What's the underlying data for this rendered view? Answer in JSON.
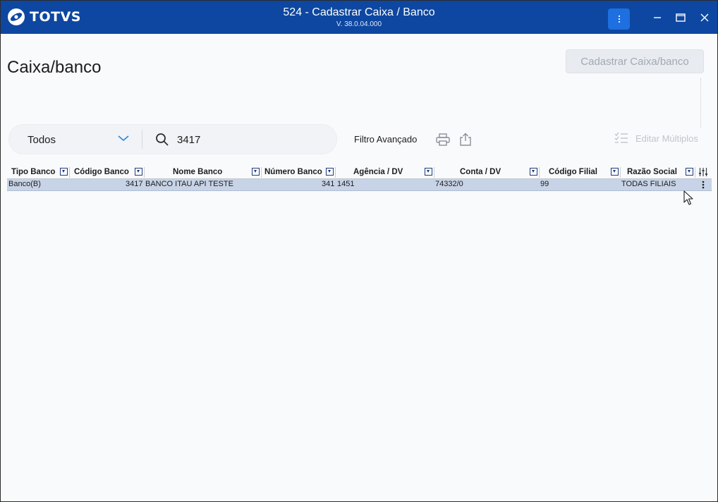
{
  "window": {
    "logo_text": "TOTVS",
    "title": "524 - Cadastrar Caixa / Banco",
    "version": "V. 38.0.04.000",
    "menu_icon": "kebab-vertical-icon",
    "controls": [
      "minimize-icon",
      "maximize-icon",
      "close-icon"
    ]
  },
  "page": {
    "title": "Caixa/banco",
    "primary_button": "Cadastrar Caixa/banco"
  },
  "filter": {
    "select_value": "Todos",
    "search_value": "3417",
    "advanced_filter": "Filtro Avançado",
    "edit_multiple": "Editar Múltiplos"
  },
  "table": {
    "columns": [
      "Tipo Banco",
      "Código Banco",
      "Nome Banco",
      "Número Banco",
      "Agência / DV",
      "Conta / DV",
      "Código Filial",
      "Razão Social"
    ],
    "rows": [
      {
        "tipo_banco": "Banco(B)",
        "codigo_banco": "3417",
        "nome_banco": "BANCO ITAU API TESTE",
        "numero_banco": "341",
        "agencia_dv": "1451",
        "conta_dv": "74332/0",
        "codigo_filial": "99",
        "razao_social": "TODAS FILIAIS"
      }
    ]
  },
  "colors": {
    "titlebar": "#0d47a1",
    "menu_button": "#1e6fe0",
    "row_selected": "#c7d3e6",
    "background": "#f9fafc"
  }
}
